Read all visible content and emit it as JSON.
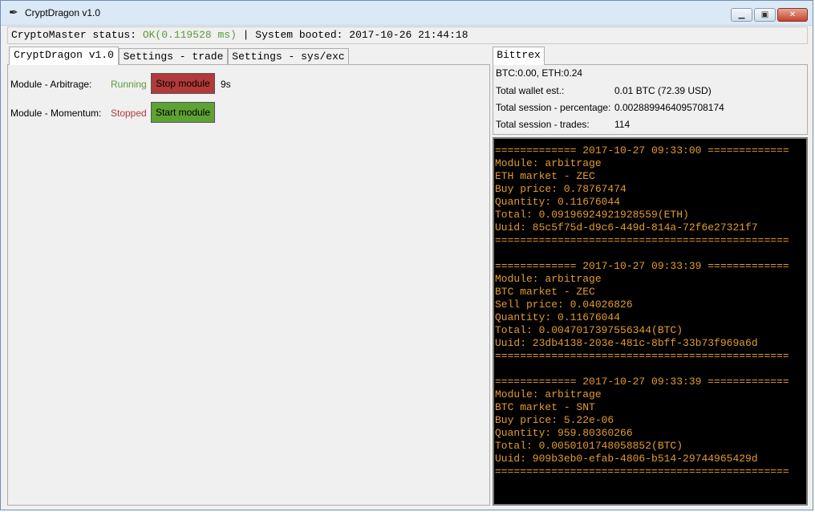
{
  "window": {
    "title": "CryptDragon v1.0",
    "app_icon": "feather-icon",
    "min_glyph": "▁",
    "max_glyph": "▣",
    "close_glyph": "✕"
  },
  "status": {
    "prefix": "CryptoMaster status: ",
    "ok": "OK(0.119528 ms)",
    "suffix": " | System booted: 2017-10-26 21:44:18"
  },
  "left_tabs": [
    {
      "label": "CryptDragon v1.0"
    },
    {
      "label": "Settings - trade"
    },
    {
      "label": "Settings - sys/exc"
    }
  ],
  "modules": [
    {
      "label": "Module - Arbitrage:",
      "status": "Running",
      "status_color": "#5b9a3a",
      "button": "Stop module",
      "button_color": "#b23a3a",
      "timer": "9s"
    },
    {
      "label": "Module - Momentum:",
      "status": "Stopped",
      "status_color": "#b23a3a",
      "button": "Start module",
      "button_color": "#5ea135",
      "timer": ""
    }
  ],
  "right_tab": {
    "label": "Bittrex"
  },
  "wallet": {
    "balances": "BTC:0.00, ETH:0.24",
    "rows": [
      {
        "key": "Total wallet est.:",
        "value": "0.01 BTC (72.39 USD)"
      },
      {
        "key": "Total session - percentage:",
        "value": "0.0028899464095708174"
      },
      {
        "key": "Total session - trades:",
        "value": "114"
      }
    ]
  },
  "log": {
    "text_color": "#e39b2c",
    "lines": [
      "============= 2017-10-27 09:33:00 =============",
      "Module: arbitrage",
      "ETH market - ZEC",
      "Buy price: 0.78767474",
      "Quantity: 0.11676044",
      "Total: 0.09196924921928559(ETH)",
      "Uuid: 85c5f75d-d9c6-449d-814a-72f6e27321f7",
      "===============================================",
      "",
      "============= 2017-10-27 09:33:39 =============",
      "Module: arbitrage",
      "BTC market - ZEC",
      "Sell price: 0.04026826",
      "Quantity: 0.11676044",
      "Total: 0.0047017397556344(BTC)",
      "Uuid: 23db4138-203e-481c-8bff-33b73f969a6d",
      "===============================================",
      "",
      "============= 2017-10-27 09:33:39 =============",
      "Module: arbitrage",
      "BTC market - SNT",
      "Buy price: 5.22e-06",
      "Quantity: 959.80360266",
      "Total: 0.0050101748058852(BTC)",
      "Uuid: 909b3eb0-efab-4806-b514-29744965429d",
      "==============================================="
    ]
  }
}
